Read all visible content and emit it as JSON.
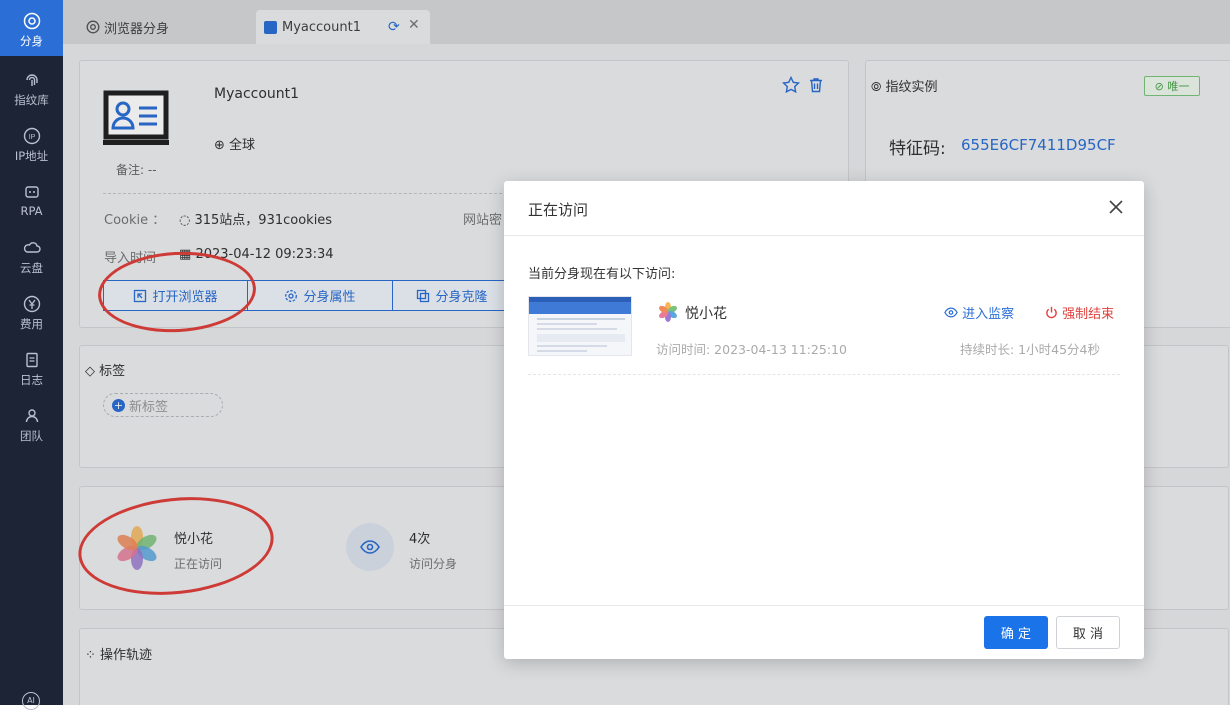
{
  "sidebar": {
    "items": [
      {
        "label": "分身",
        "icon": "chrome-icon",
        "active": true
      },
      {
        "label": "指纹库",
        "icon": "fingerprint-icon"
      },
      {
        "label": "IP地址",
        "icon": "ip-icon"
      },
      {
        "label": "RPA",
        "icon": "robot-icon"
      },
      {
        "label": "云盘",
        "icon": "cloud-icon"
      },
      {
        "label": "费用",
        "icon": "yen-icon"
      },
      {
        "label": "日志",
        "icon": "log-icon"
      },
      {
        "label": "团队",
        "icon": "team-icon"
      }
    ],
    "bottom_icon_text": "AI"
  },
  "tabs": [
    {
      "label": "浏览器分身"
    },
    {
      "label": "Myaccount1"
    }
  ],
  "profile": {
    "name": "Myaccount1",
    "region": "全球",
    "note": "备注: --",
    "cookie_label": "Cookie",
    "cookie_sep": "：",
    "cookie_value": "315站点，931cookies",
    "site_label": "网站密",
    "import_label": "导入时间",
    "import_value": "2023-04-12 09:23:34",
    "buttons": {
      "open_browser": "打开浏览器",
      "profile_props": "分身属性",
      "profile_clone": "分身克隆"
    }
  },
  "fingerprint": {
    "title": "指纹实例",
    "badge": "唯一",
    "code_label": "特征码:",
    "code_value": "655E6CF7411D95CF"
  },
  "tags": {
    "title": "标签",
    "new_tag": "新标签"
  },
  "visitor": {
    "name": "悦小花",
    "status": "正在访问",
    "count": "4次",
    "count_label": "访问分身"
  },
  "track": {
    "title": "操作轨迹"
  },
  "modal": {
    "title": "正在访问",
    "subtitle": "当前分身现在有以下访问:",
    "user": "悦小花",
    "monitor": "进入监察",
    "force_end": "强制结束",
    "visit_time": "访问时间: 2023-04-13 11:25:10",
    "duration": "持续时长: 1小时45分4秒",
    "ok": "确 定",
    "cancel": "取 消"
  },
  "colors": {
    "primary": "#2b6fd6",
    "danger": "#e0403c",
    "success": "#4aa24a",
    "sidebar_bg": "#1d2435"
  }
}
